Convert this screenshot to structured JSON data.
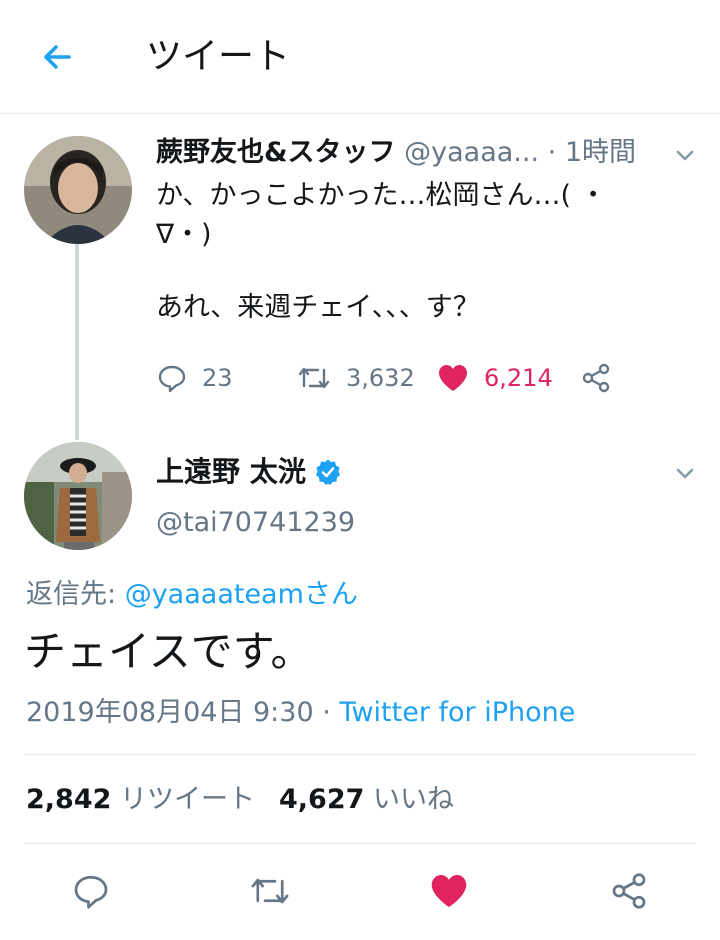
{
  "header": {
    "title": "ツイート"
  },
  "parent_tweet": {
    "author_name": "蕨野友也&スタッフ",
    "handle": "@yaaaa...",
    "time": "· 1時間",
    "text_line1": "か、かっこよかった…松岡さん…( ・",
    "text_line2": "∇・)",
    "text_line3": "あれ、来週チェイ、、、す？",
    "replies": "23",
    "retweets": "3,632",
    "likes": "6,214"
  },
  "main_tweet": {
    "author_name": "上遠野 太洸",
    "handle": "@tai70741239",
    "replying_label": "返信先:",
    "replying_to": "@yaaaateamさん",
    "text": "チェイスです。",
    "date": "2019年08月04日 9:30",
    "separator": "·",
    "client": "Twitter for iPhone"
  },
  "stats": {
    "retweets_count": "2,842",
    "retweets_label": "リツイート",
    "likes_count": "4,627",
    "likes_label": "いいね"
  },
  "colors": {
    "accent": "#1da1f2",
    "like": "#e0245e",
    "muted": "#657786",
    "divider": "#e6ecf0"
  },
  "icons": [
    "back-arrow-icon",
    "chevron-down-icon",
    "reply-icon",
    "retweet-icon",
    "heart-icon",
    "share-icon",
    "verified-badge-icon"
  ]
}
